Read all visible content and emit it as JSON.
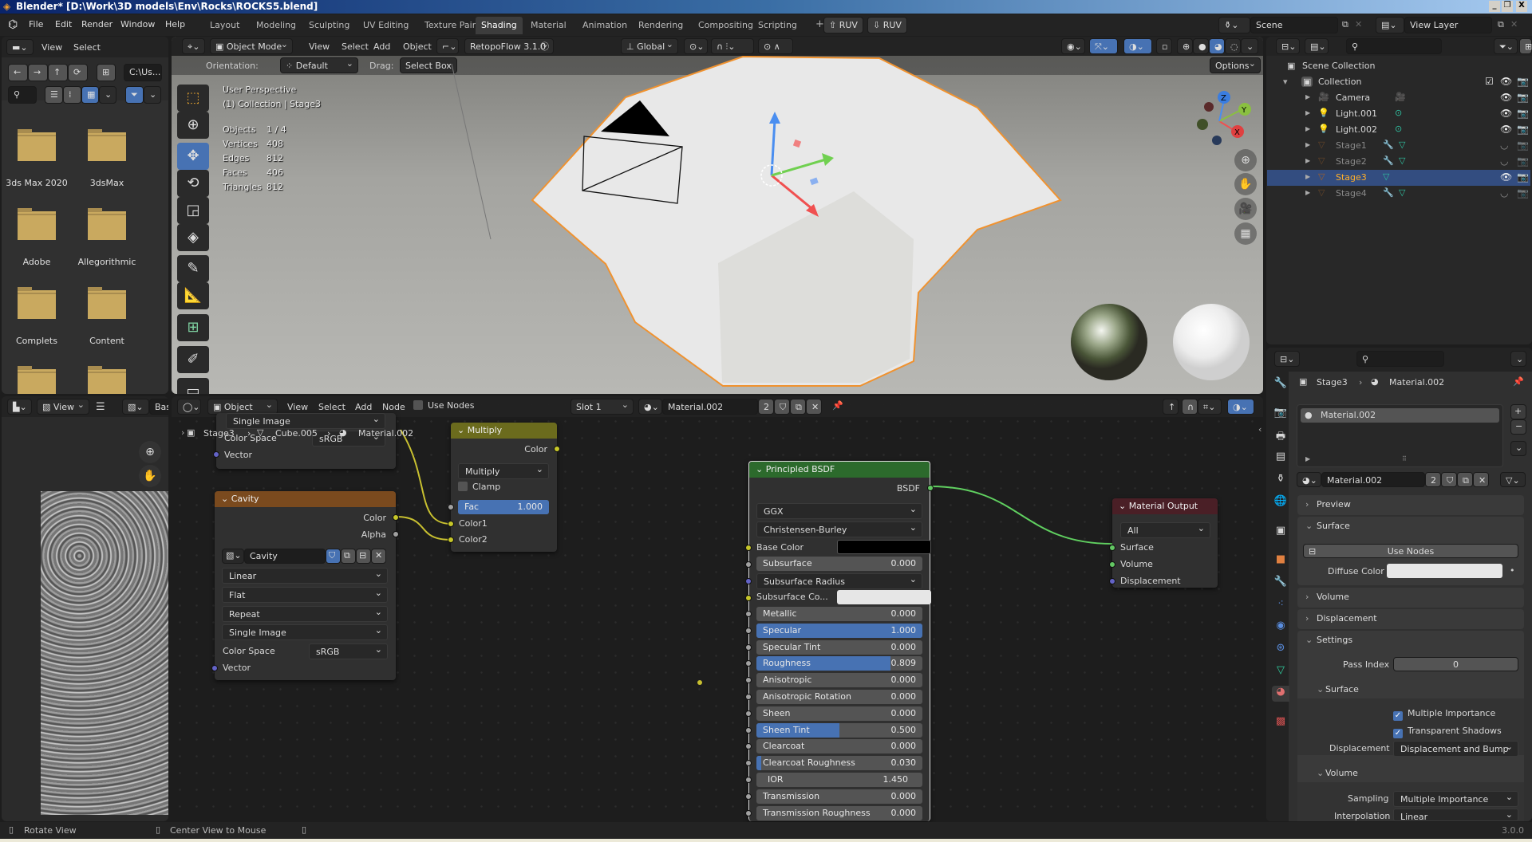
{
  "window": {
    "title": "Blender* [D:\\Work\\3D models\\Env\\Rocks\\ROCKS5.blend]",
    "controls": [
      "_",
      "❐",
      "X"
    ]
  },
  "topbar": {
    "menus": [
      "File",
      "Edit",
      "Render",
      "Window",
      "Help"
    ],
    "workspaces": [
      "Layout",
      "Modeling",
      "Sculpting",
      "UV Editing",
      "Texture Paint",
      "Shading",
      "Material",
      "Animation",
      "Rendering",
      "Compositing",
      "Scripting"
    ],
    "active_workspace": "Shading",
    "add_tab": "+",
    "ruv_buttons": [
      "RUV",
      "RUV"
    ],
    "scene": "Scene",
    "view_layer": "View Layer"
  },
  "file_browser": {
    "menus": [
      "View",
      "Select"
    ],
    "path": "C:\\Us...",
    "folders": [
      "3ds Max 2020",
      "3dsMax",
      "Adobe",
      "Allegorithmic",
      "Complets",
      "Content",
      "",
      ""
    ],
    "folder_color": "#c9a95f"
  },
  "viewport": {
    "mode": "Object Mode",
    "menus": [
      "View",
      "Select",
      "Add",
      "Object"
    ],
    "addon": "RetopoFlow 3.1.0",
    "transform_orientation": "Global",
    "orientation_label": "Orientation:",
    "orientation": "Default",
    "drag_label": "Drag:",
    "drag": "Select Box",
    "options": "Options",
    "overlay_title": "User Perspective",
    "overlay_subtitle": "(1) Collection | Stage3",
    "stats": [
      {
        "label": "Objects",
        "value": "1 / 4"
      },
      {
        "label": "Vertices",
        "value": "408"
      },
      {
        "label": "Edges",
        "value": "812"
      },
      {
        "label": "Faces",
        "value": "406"
      },
      {
        "label": "Triangles",
        "value": "812"
      }
    ],
    "selection_color": "#f0922f",
    "axes": [
      "X",
      "Y",
      "Z"
    ]
  },
  "outliner": {
    "root": "Scene Collection",
    "collection": "Collection",
    "items": [
      {
        "name": "Camera",
        "type": "camera",
        "visible": true
      },
      {
        "name": "Light.001",
        "type": "light",
        "visible": true
      },
      {
        "name": "Light.002",
        "type": "light",
        "visible": true
      },
      {
        "name": "Stage1",
        "type": "mesh",
        "visible": false
      },
      {
        "name": "Stage2",
        "type": "mesh",
        "visible": false
      },
      {
        "name": "Stage3",
        "type": "mesh",
        "visible": true,
        "selected": true
      },
      {
        "name": "Stage4",
        "type": "mesh",
        "visible": false
      }
    ]
  },
  "properties": {
    "breadcrumb": [
      "Stage3",
      "Material.002"
    ],
    "slot": "Material.002",
    "material": "Material.002",
    "users": "2",
    "panels": {
      "preview": "Preview",
      "surface": "Surface",
      "use_nodes": "Use Nodes",
      "diffuse_label": "Diffuse Color",
      "diffuse_color": "#e6e6e6",
      "volume": "Volume",
      "displacement": "Displacement",
      "settings": "Settings",
      "pass_index_label": "Pass Index",
      "pass_index": "0",
      "surface_sub": "Surface",
      "multiple_importance": "Multiple Importance",
      "transparent_shadows": "Transparent Shadows",
      "displacement_label": "Displacement",
      "displacement_value": "Displacement and Bump",
      "volume_sub": "Volume",
      "sampling_label": "Sampling",
      "sampling": "Multiple Importance",
      "interpolation_label": "Interpolation",
      "interpolation": "Linear"
    }
  },
  "image_editor": {
    "view": "View",
    "image": "Base"
  },
  "node_editor": {
    "object": "Object",
    "menus": [
      "View",
      "Select",
      "Add",
      "Node"
    ],
    "use_nodes": "Use Nodes",
    "slot": "Slot 1",
    "material": "Material.002",
    "users": "2",
    "breadcrumb": [
      "Stage3",
      "Cube.005",
      "Material.002"
    ],
    "image_node_top": {
      "projection": "Single Image",
      "color_space_label": "Color Space",
      "color_space": "sRGB",
      "vector": "Vector"
    },
    "cavity": {
      "title": "Cavity",
      "out_color": "Color",
      "out_alpha": "Alpha",
      "image": "Cavity",
      "interpolation": "Linear",
      "projection": "Flat",
      "extension": "Repeat",
      "source": "Single Image",
      "color_space_label": "Color Space",
      "color_space": "sRGB",
      "vector": "Vector",
      "header_color": "#7a4a1e"
    },
    "multiply": {
      "title": "Multiply",
      "out": "Color",
      "blend": "Multiply",
      "clamp": "Clamp",
      "fac_label": "Fac",
      "fac": "1.000",
      "fac_fraction": 1.0,
      "color1": "Color1",
      "color2": "Color2",
      "header_color": "#6b6b1d"
    },
    "bsdf": {
      "title": "Principled BSDF",
      "out": "BSDF",
      "distribution": "GGX",
      "subsurface_method": "Christensen-Burley",
      "base_color_label": "Base Color",
      "base_color": "#000000",
      "subsurface_color_label": "Subsurface Co...",
      "subsurface_color": "#e6e6e6",
      "subsurface_radius": "Subsurface Radius",
      "header_color": "#2c6a2c",
      "fields": [
        {
          "label": "Subsurface",
          "value": "0.000",
          "fill": 0
        },
        {
          "label": "Metallic",
          "value": "0.000",
          "fill": 0
        },
        {
          "label": "Specular",
          "value": "1.000",
          "fill": 1
        },
        {
          "label": "Specular Tint",
          "value": "0.000",
          "fill": 0
        },
        {
          "label": "Roughness",
          "value": "0.809",
          "fill": 0.809
        },
        {
          "label": "Anisotropic",
          "value": "0.000",
          "fill": 0
        },
        {
          "label": "Anisotropic Rotation",
          "value": "0.000",
          "fill": 0
        },
        {
          "label": "Sheen",
          "value": "0.000",
          "fill": 0
        },
        {
          "label": "Sheen Tint",
          "value": "0.500",
          "fill": 0.5
        },
        {
          "label": "Clearcoat",
          "value": "0.000",
          "fill": 0
        },
        {
          "label": "Clearcoat Roughness",
          "value": "0.030",
          "fill": 0.03
        },
        {
          "label": "IOR",
          "value": "1.450",
          "fill": 0
        },
        {
          "label": "Transmission",
          "value": "0.000",
          "fill": 0
        },
        {
          "label": "Transmission Roughness",
          "value": "0.000",
          "fill": 0
        }
      ]
    },
    "output": {
      "title": "Material Output",
      "target": "All",
      "surface": "Surface",
      "volume": "Volume",
      "displacement": "Displacement",
      "header_color": "#4a1f26"
    }
  },
  "statusbar": {
    "hints": [
      "Rotate View",
      "Center View to Mouse",
      ""
    ],
    "version": "3.0.0"
  }
}
